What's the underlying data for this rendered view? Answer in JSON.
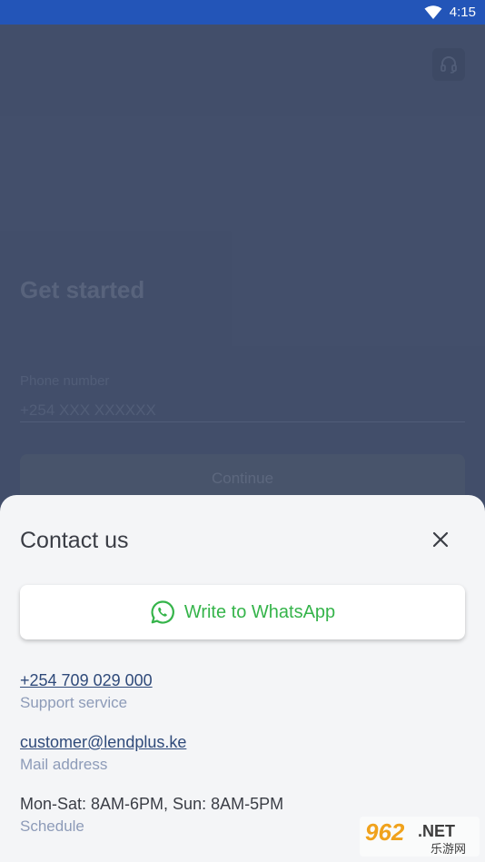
{
  "status_bar": {
    "time": "4:15"
  },
  "main": {
    "title": "Get started",
    "phone_label": "Phone number",
    "phone_placeholder": "+254 XXX XXXXXX",
    "continue_label": "Continue"
  },
  "sheet": {
    "title": "Contact us",
    "whatsapp_label": "Write to WhatsApp",
    "contacts": [
      {
        "value": "+254 709 029 000",
        "label": "Support service"
      },
      {
        "value": "customer@lendplus.ke",
        "label": "Mail address"
      },
      {
        "value": "Mon-Sat: 8AM-6PM, Sun: 8AM-5PM",
        "label": "Schedule"
      }
    ]
  },
  "watermark": {
    "number": "962",
    "suffix": ".NET",
    "chinese": "乐游网"
  },
  "colors": {
    "status_bar": "#2355b8",
    "whatsapp_green": "#35b44a",
    "link": "#2f4a7a",
    "muted": "#8d9bb8"
  }
}
